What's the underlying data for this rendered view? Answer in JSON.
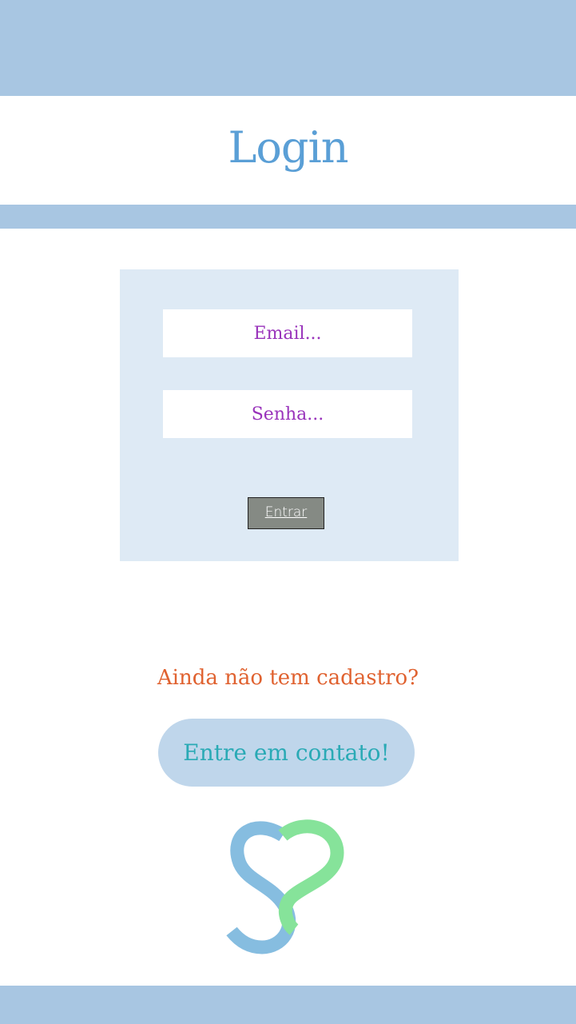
{
  "header": {
    "title": "Login"
  },
  "login_form": {
    "email_placeholder": "Email...",
    "password_placeholder": "Senha...",
    "submit_label": "Entrar"
  },
  "signup": {
    "prompt": "Ainda não tem cadastro?",
    "contact_label": "Entre em contato!"
  },
  "logo": {
    "icon": "heart-s-logo"
  },
  "colors": {
    "bars": "#a8c6e2",
    "title": "#5a9fd6",
    "panel": "#deeaf5",
    "placeholder_text": "#9933bb",
    "submit_bg": "#858a84",
    "prompt_text": "#e06230",
    "contact_bg": "#bfd6eb",
    "contact_text": "#2aaab5",
    "logo_blue": "#86bde0",
    "logo_green": "#86e39a"
  }
}
